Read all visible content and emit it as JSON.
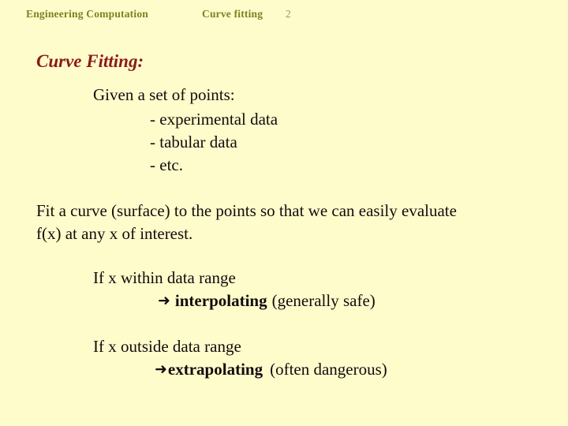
{
  "slide": {
    "background_color": "#FFFCCC",
    "header": {
      "course": "Engineering Computation",
      "topic": "Curve fitting",
      "slide_number": "2",
      "color": "#80801E"
    },
    "title": {
      "text": "Curve Fitting:",
      "color": "#8B1A1A"
    },
    "given_block": {
      "heading": "Given a set of points:",
      "items": [
        "- experimental data",
        "- tabular data",
        "- etc."
      ]
    },
    "paragraph": {
      "line1": "Fit a curve (surface) to the points so that we can easily evaluate",
      "line2": "f(x) at any x of interest."
    },
    "interpolation": {
      "condition": "If x within data range",
      "arrow": "arrow-right-icon",
      "arrow_glyph": "➜",
      "term": "interpolating",
      "note": "(generally safe)"
    },
    "extrapolation": {
      "condition": "If x outside data range",
      "arrow": "arrow-right-icon",
      "arrow_glyph": "➜",
      "term": "extrapolating",
      "note": "(often dangerous)"
    }
  }
}
